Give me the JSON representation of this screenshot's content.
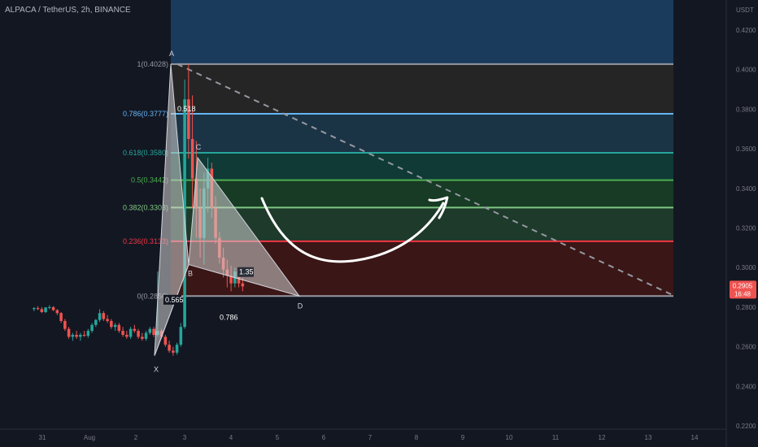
{
  "header": {
    "symbol_line": "ALPACA / TetherUS, 2h, BINANCE"
  },
  "axis": {
    "unit": "USDT",
    "y_ticks": [
      "0.4200",
      "0.4000",
      "0.3800",
      "0.3600",
      "0.3400",
      "0.3200",
      "0.3000",
      "0.2800",
      "0.2600",
      "0.2400",
      "0.2200"
    ],
    "x_ticks": [
      "31",
      "Aug",
      "2",
      "3",
      "4",
      "5",
      "6",
      "7",
      "8",
      "9",
      "10",
      "11",
      "12",
      "13",
      "14"
    ],
    "price_badge": {
      "price": "0.2905",
      "countdown": "16:48"
    }
  },
  "fib_levels": [
    {
      "label": "1(0.4028)",
      "price": 0.4028,
      "color": "#9598a1"
    },
    {
      "label": "0.786(0.3777)",
      "price": 0.3777,
      "color": "#64b5f6"
    },
    {
      "label": "0.618(0.3580)",
      "price": 0.358,
      "color": "#26a69a"
    },
    {
      "label": "0.5(0.3442)",
      "price": 0.3442,
      "color": "#4caf50"
    },
    {
      "label": "0.382(0.3303)",
      "price": 0.3303,
      "color": "#81c784"
    },
    {
      "label": "0.236(0.3133)",
      "price": 0.3133,
      "color": "#f23645"
    },
    {
      "label": "0(0.2856)",
      "price": 0.2856,
      "color": "#9598a1"
    }
  ],
  "fib_top_line": {
    "price": 0.4362,
    "color": "#81c784"
  },
  "zone_colors": [
    "#1a3b5c",
    "#252525",
    "#1b3445",
    "#0f3a36",
    "#173b24",
    "#1d3a2b",
    "#3a1616",
    "#3a1616"
  ],
  "pattern": {
    "labels": {
      "X": "X",
      "A": "A",
      "B": "B",
      "C": "C",
      "D": "D"
    },
    "ratios": {
      "ab": "0.518",
      "xb": "0.565",
      "bc": "0.786",
      "cd": "1.35"
    }
  },
  "chart_data": {
    "type": "candlestick",
    "title": "",
    "xlabel": "",
    "ylabel": "USDT",
    "ylim": [
      0.22,
      0.44
    ],
    "last_price": 0.2905,
    "harmonic_points": {
      "X": 0.2555,
      "A": 0.4028,
      "B": 0.3015,
      "C": 0.3555,
      "D": 0.2856
    },
    "candles_ohlc": [
      [
        0.279,
        0.28,
        0.278,
        0.2795
      ],
      [
        0.2795,
        0.2805,
        0.2785,
        0.279
      ],
      [
        0.279,
        0.28,
        0.277,
        0.2775
      ],
      [
        0.2775,
        0.28,
        0.277,
        0.2798
      ],
      [
        0.2798,
        0.281,
        0.279,
        0.28
      ],
      [
        0.28,
        0.2805,
        0.278,
        0.2785
      ],
      [
        0.2785,
        0.279,
        0.276,
        0.277
      ],
      [
        0.277,
        0.2775,
        0.272,
        0.273
      ],
      [
        0.273,
        0.274,
        0.268,
        0.269
      ],
      [
        0.269,
        0.27,
        0.264,
        0.265
      ],
      [
        0.265,
        0.267,
        0.263,
        0.266
      ],
      [
        0.266,
        0.268,
        0.264,
        0.265
      ],
      [
        0.265,
        0.267,
        0.263,
        0.266
      ],
      [
        0.266,
        0.268,
        0.265,
        0.2655
      ],
      [
        0.2655,
        0.269,
        0.2645,
        0.268
      ],
      [
        0.268,
        0.272,
        0.267,
        0.271
      ],
      [
        0.271,
        0.274,
        0.27,
        0.2735
      ],
      [
        0.2735,
        0.279,
        0.2725,
        0.277
      ],
      [
        0.277,
        0.278,
        0.273,
        0.274
      ],
      [
        0.274,
        0.276,
        0.272,
        0.273
      ],
      [
        0.273,
        0.274,
        0.269,
        0.27
      ],
      [
        0.27,
        0.272,
        0.268,
        0.271
      ],
      [
        0.271,
        0.272,
        0.267,
        0.268
      ],
      [
        0.268,
        0.27,
        0.265,
        0.266
      ],
      [
        0.266,
        0.268,
        0.264,
        0.265
      ],
      [
        0.265,
        0.27,
        0.264,
        0.269
      ],
      [
        0.269,
        0.271,
        0.267,
        0.268
      ],
      [
        0.268,
        0.269,
        0.264,
        0.265
      ],
      [
        0.265,
        0.267,
        0.263,
        0.264
      ],
      [
        0.264,
        0.268,
        0.263,
        0.267
      ],
      [
        0.267,
        0.27,
        0.266,
        0.269
      ],
      [
        0.269,
        0.27,
        0.265,
        0.266
      ],
      [
        0.266,
        0.298,
        0.265,
        0.268
      ],
      [
        0.268,
        0.269,
        0.264,
        0.265
      ],
      [
        0.265,
        0.266,
        0.26,
        0.261
      ],
      [
        0.261,
        0.263,
        0.257,
        0.258
      ],
      [
        0.258,
        0.26,
        0.2555,
        0.257
      ],
      [
        0.257,
        0.262,
        0.256,
        0.261
      ],
      [
        0.261,
        0.272,
        0.26,
        0.27
      ],
      [
        0.27,
        0.395,
        0.269,
        0.385
      ],
      [
        0.385,
        0.4028,
        0.355,
        0.365
      ],
      [
        0.365,
        0.387,
        0.33,
        0.345
      ],
      [
        0.345,
        0.364,
        0.315,
        0.33
      ],
      [
        0.33,
        0.34,
        0.305,
        0.315
      ],
      [
        0.315,
        0.348,
        0.3015,
        0.34
      ],
      [
        0.34,
        0.3555,
        0.328,
        0.35
      ],
      [
        0.35,
        0.353,
        0.325,
        0.33
      ],
      [
        0.33,
        0.336,
        0.312,
        0.315
      ],
      [
        0.315,
        0.318,
        0.302,
        0.305
      ],
      [
        0.305,
        0.31,
        0.295,
        0.299
      ],
      [
        0.299,
        0.304,
        0.29,
        0.296
      ],
      [
        0.296,
        0.301,
        0.288,
        0.292
      ],
      [
        0.292,
        0.3,
        0.29,
        0.298
      ],
      [
        0.298,
        0.3,
        0.29,
        0.292
      ],
      [
        0.292,
        0.295,
        0.288,
        0.2905
      ]
    ]
  }
}
